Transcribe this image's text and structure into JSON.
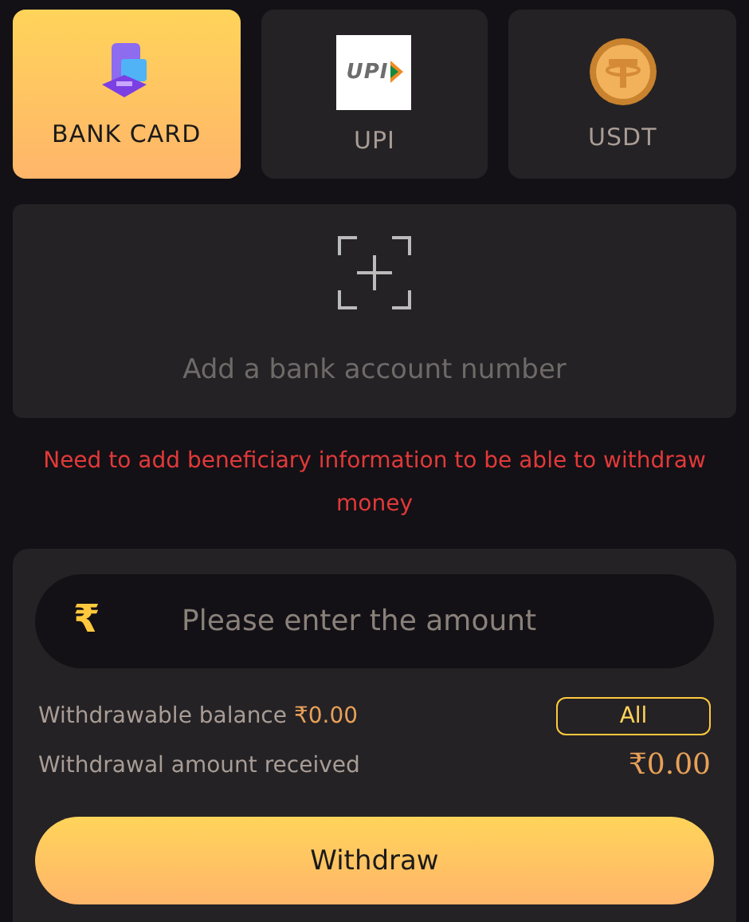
{
  "methods": [
    {
      "kind": "card",
      "label": "BANK CARD",
      "selected": true
    },
    {
      "kind": "upi",
      "label": "UPI",
      "logo_text": "UPI",
      "selected": false
    },
    {
      "kind": "coin",
      "label": "USDT",
      "selected": false
    }
  ],
  "add_account": {
    "label": "Add a bank account number"
  },
  "warning": "Need to add beneficiary information to be able to withdraw money",
  "amount_field": {
    "currency_symbol": "₹",
    "placeholder": "Please enter the amount"
  },
  "balance": {
    "label": "Withdrawable balance",
    "value": "₹0.00",
    "all_button": "All"
  },
  "received": {
    "label": "Withdrawal amount received",
    "value": "₹0.00"
  },
  "submit": "Withdraw"
}
